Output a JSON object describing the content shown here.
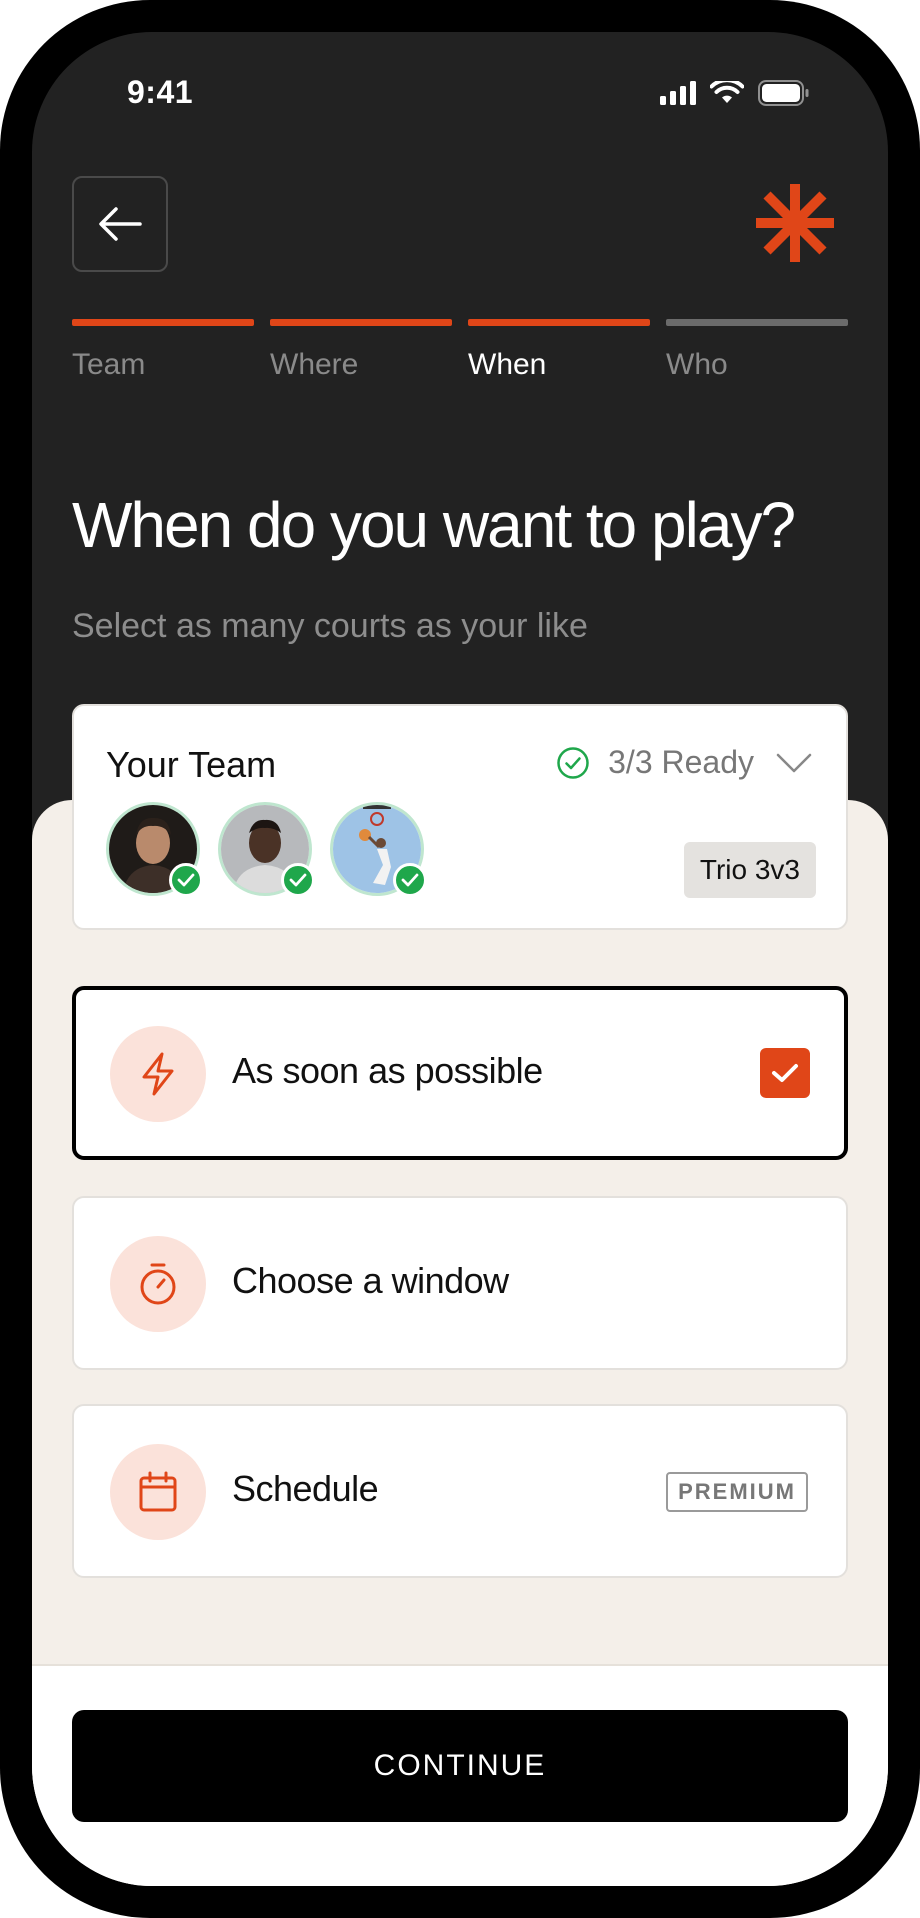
{
  "status_bar": {
    "time": "9:41"
  },
  "stepper": {
    "steps": [
      {
        "label": "Team",
        "state": "done"
      },
      {
        "label": "Where",
        "state": "done"
      },
      {
        "label": "When",
        "state": "current"
      },
      {
        "label": "Who",
        "state": "upcoming"
      }
    ]
  },
  "header": {
    "title": "When do you want to play?",
    "subtitle": "Select as many courts as your like"
  },
  "team": {
    "title": "Your Team",
    "status": "3/3 Ready",
    "badge": "Trio 3v3",
    "members_ready": 3,
    "members_total": 3
  },
  "options": [
    {
      "label": "As soon as possible",
      "icon": "lightning-icon",
      "selected": true
    },
    {
      "label": "Choose a window",
      "icon": "stopwatch-icon",
      "selected": false
    },
    {
      "label": "Schedule",
      "icon": "calendar-icon",
      "selected": false,
      "tag": "PREMIUM"
    }
  ],
  "footer": {
    "continue_label": "CONTINUE"
  },
  "colors": {
    "accent": "#e04618",
    "dark_bg": "#222222",
    "light_bg": "#f4efe9",
    "ready_green": "#1fa74b"
  }
}
